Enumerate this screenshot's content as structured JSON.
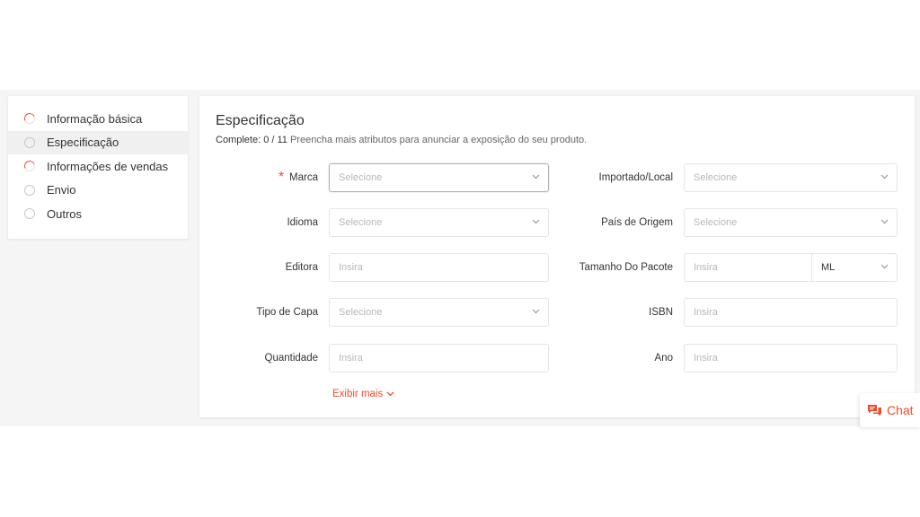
{
  "sidebar": {
    "items": [
      {
        "label": "Informação básica",
        "state": "partial"
      },
      {
        "label": "Especificação",
        "state": "empty",
        "active": true
      },
      {
        "label": "Informações de vendas",
        "state": "partial"
      },
      {
        "label": "Envio",
        "state": "empty"
      },
      {
        "label": "Outros",
        "state": "empty"
      }
    ]
  },
  "spec": {
    "title": "Especificação",
    "progress_prefix": "Complete: 0 / 11",
    "progress_hint": "Preencha mais atributos para anunciar a exposição do seu produto.",
    "required_mark": "*",
    "fields": {
      "marca": {
        "label": "Marca",
        "placeholder": "Selecione"
      },
      "importado": {
        "label": "Importado/Local",
        "placeholder": "Selecione"
      },
      "idioma": {
        "label": "Idioma",
        "placeholder": "Selecione"
      },
      "pais": {
        "label": "País de Origem",
        "placeholder": "Selecione"
      },
      "editora": {
        "label": "Editora",
        "placeholder": "Insira"
      },
      "tamanho": {
        "label": "Tamanho Do Pacote",
        "placeholder": "Insira",
        "unit": "ML"
      },
      "capa": {
        "label": "Tipo de Capa",
        "placeholder": "Selecione"
      },
      "isbn": {
        "label": "ISBN",
        "placeholder": "Insira"
      },
      "quantidade": {
        "label": "Quantidade",
        "placeholder": "Insira"
      },
      "ano": {
        "label": "Ano",
        "placeholder": "Insira"
      }
    },
    "show_more": "Exibir mais"
  },
  "chat": {
    "label": "Chat"
  },
  "colors": {
    "accent": "#ee4d2d"
  }
}
